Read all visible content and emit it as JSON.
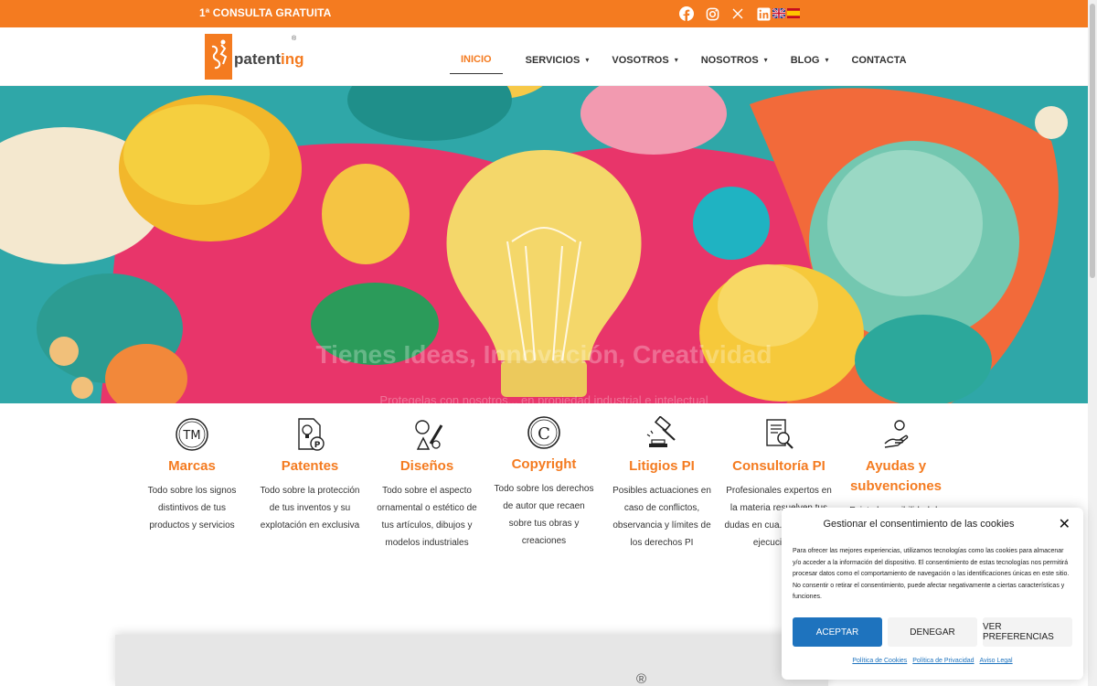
{
  "topbar": {
    "promo": "1ª CONSULTA GRATUITA",
    "socials": [
      "facebook-icon",
      "instagram-icon",
      "x-icon",
      "linkedin-icon"
    ],
    "languages": [
      "english-flag",
      "spanish-flag"
    ],
    "accent": "#f47b20"
  },
  "header": {
    "logo_text_a": "patent",
    "logo_text_b": "ing",
    "logo_reg": "®",
    "nav": [
      {
        "label": "INICIO",
        "active": true
      },
      {
        "label": "SERVICIOS",
        "caret": "▾"
      },
      {
        "label": "VOSOTROS",
        "caret": "▾"
      },
      {
        "label": "NOSOTROS",
        "caret": "▾"
      },
      {
        "label": "BLOG",
        "caret": "▾"
      },
      {
        "label": "CONTACTA"
      }
    ]
  },
  "hero": {
    "title": "Tienes Ideas, Innovación, Creatividad",
    "subtitle": "Protegelas con nosotros... en propiedad industrial e intelectual"
  },
  "services": [
    {
      "icon": "trademark-icon",
      "title": "Marcas",
      "desc": "Todo sobre los signos distintivos de tus productos y servicios"
    },
    {
      "icon": "patent-icon",
      "title": "Patentes",
      "desc": "Todo sobre la protección de tus inventos y su explotación en exclusiva"
    },
    {
      "icon": "design-icon",
      "title": "Diseños",
      "desc": "Todo sobre el aspecto ornamental o estético de tus artículos, dibujos y modelos industriales"
    },
    {
      "icon": "copyright-icon",
      "title": "Copyright",
      "desc": "Todo sobre los derechos de autor que recaen sobre tus obras y creaciones"
    },
    {
      "icon": "gavel-icon",
      "title": "Litigios PI",
      "desc": "Posibles actuaciones en caso de conflictos, observancia y límites de los derechos PI"
    },
    {
      "icon": "consulting-icon",
      "title": "Consultoría PI",
      "desc": "Profesionales expertos en la materia resuelven tus dudas en cua... de prepa... ejecución de"
    },
    {
      "icon": "grant-icon",
      "title": "Ayudas y subvenciones",
      "desc": "Existe la posibilidad de"
    }
  ],
  "lower": {
    "reg": "®"
  },
  "cookie": {
    "title": "Gestionar el consentimiento de las cookies",
    "text": "Para ofrecer las mejores experiencias, utilizamos tecnologías como las cookies para almacenar y/o acceder a la información del dispositivo. El consentimiento de estas tecnologías nos permitirá procesar datos como el comportamiento de navegación o las identificaciones únicas en este sitio. No consentir o retirar el consentimiento, puede afectar negativamente a ciertas características y funciones.",
    "accept": "ACEPTAR",
    "deny": "DENEGAR",
    "prefs": "VER PREFERENCIAS",
    "links": [
      "Política de Cookies",
      "Política de Privacidad",
      "Aviso Legal"
    ],
    "close": "✕"
  }
}
